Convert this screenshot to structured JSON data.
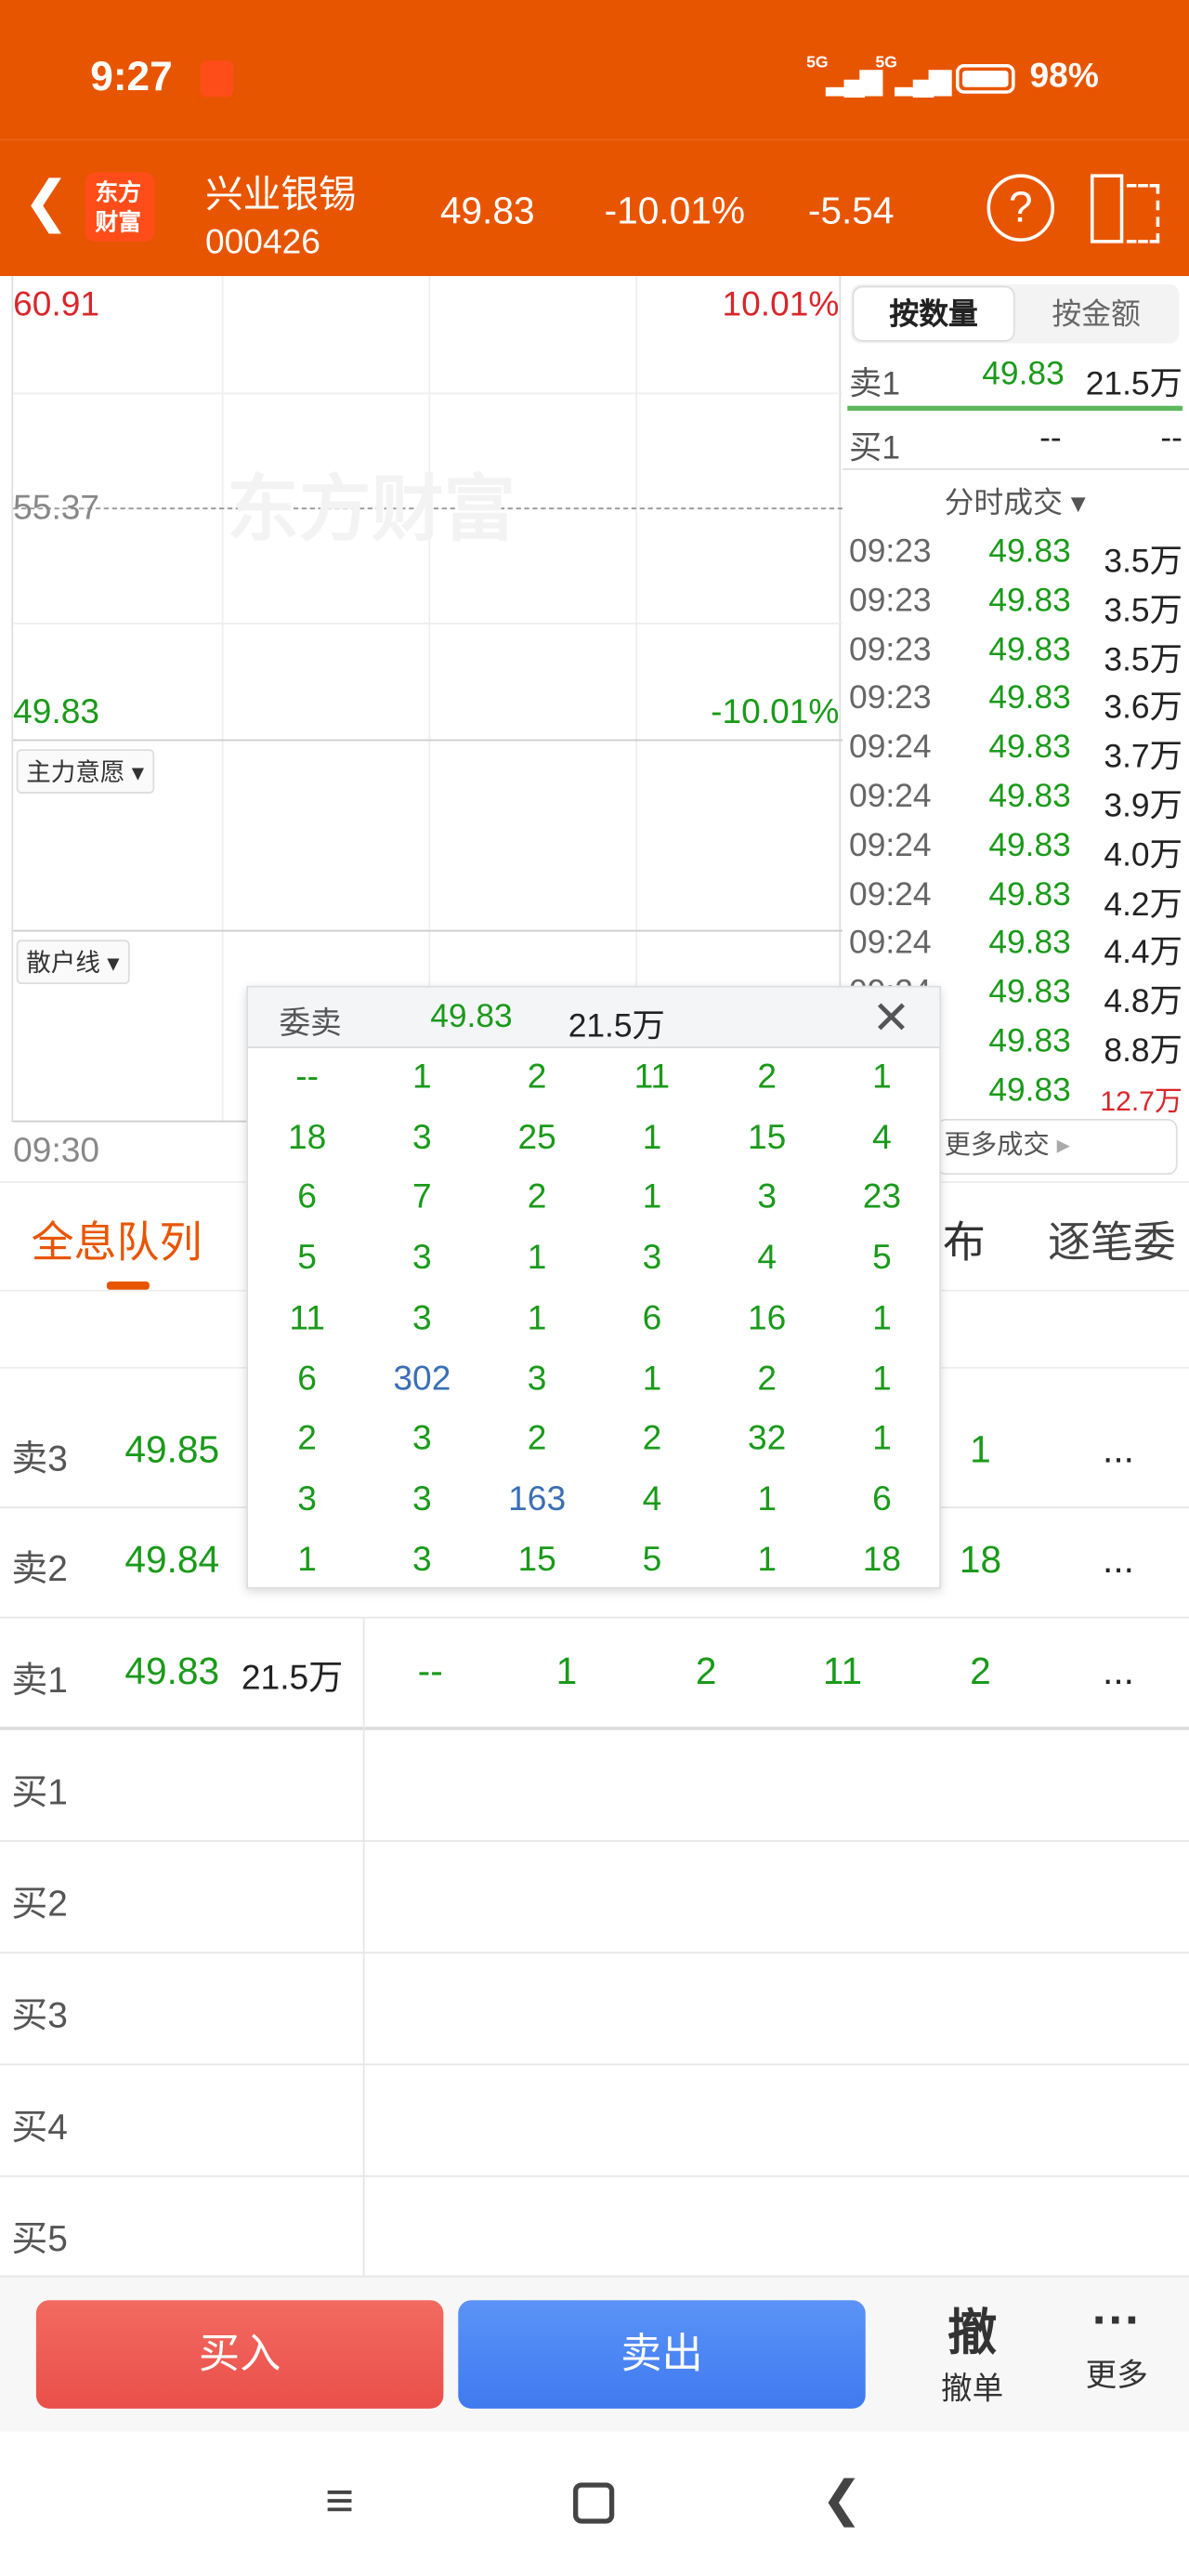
{
  "status": {
    "time": "9:27",
    "net1": "5G",
    "net2": "5G",
    "battery": "98%"
  },
  "header": {
    "logo_text": "东方财富",
    "name": "兴业银锡",
    "code": "000426",
    "price": "49.83",
    "change_pct": "-10.01%",
    "change": "-5.54"
  },
  "chart": {
    "high": "60.91",
    "high_pct": "10.01%",
    "mid": "55.37",
    "low": "49.83",
    "low_pct": "-10.01%",
    "watermark": "东方财富",
    "indicator1": "主力意愿",
    "indicator2": "散户线",
    "time_start": "09:30"
  },
  "side": {
    "tab_qty": "按数量",
    "tab_amt": "按金额",
    "sell1": {
      "label": "卖1",
      "price": "49.83",
      "vol": "21.5万"
    },
    "buy1": {
      "label": "买1",
      "price": "--",
      "vol": "--"
    },
    "trades_title": "分时成交",
    "more": "更多成交",
    "trades": [
      [
        "09:23",
        "49.83",
        "3.5万"
      ],
      [
        "09:23",
        "49.83",
        "3.5万"
      ],
      [
        "09:23",
        "49.83",
        "3.5万"
      ],
      [
        "09:23",
        "49.83",
        "3.6万"
      ],
      [
        "09:24",
        "49.83",
        "3.7万"
      ],
      [
        "09:24",
        "49.83",
        "3.9万"
      ],
      [
        "09:24",
        "49.83",
        "4.0万"
      ],
      [
        "09:24",
        "49.83",
        "4.2万"
      ],
      [
        "09:24",
        "49.83",
        "4.4万"
      ],
      [
        "09:24",
        "49.83",
        "4.8万"
      ],
      [
        "",
        "49.83",
        "8.8万"
      ],
      [
        "",
        "49.83",
        "12.7万"
      ]
    ]
  },
  "tabs": [
    "全息队列",
    "布",
    "逐笔委"
  ],
  "book": {
    "sell3": {
      "label": "卖3",
      "price": "49.85",
      "cells": [
        "",
        "",
        "",
        "",
        "1",
        "..."
      ]
    },
    "sell2": {
      "label": "卖2",
      "price": "49.84",
      "cells": [
        "",
        "",
        "",
        "",
        "18",
        "..."
      ]
    },
    "sell1": {
      "label": "卖1",
      "price": "49.83",
      "vol": "21.5万",
      "cells": [
        "--",
        "1",
        "2",
        "11",
        "2",
        "..."
      ]
    },
    "buys": [
      "买1",
      "买2",
      "买3",
      "买4",
      "买5"
    ]
  },
  "popup": {
    "title": "委卖",
    "price": "49.83",
    "vol": "21.5万",
    "rows": [
      [
        "--",
        "1",
        "2",
        "11",
        "2",
        "1"
      ],
      [
        "18",
        "3",
        "25",
        "1",
        "15",
        "4"
      ],
      [
        "6",
        "7",
        "2",
        "1",
        "3",
        "23"
      ],
      [
        "5",
        "3",
        "1",
        "3",
        "4",
        "5"
      ],
      [
        "11",
        "3",
        "1",
        "6",
        "16",
        "1"
      ],
      [
        "6",
        "302",
        "3",
        "1",
        "2",
        "1"
      ],
      [
        "2",
        "3",
        "2",
        "2",
        "32",
        "1"
      ],
      [
        "3",
        "3",
        "163",
        "4",
        "1",
        "6"
      ],
      [
        "1",
        "3",
        "15",
        "5",
        "1",
        "18"
      ]
    ],
    "highlight": [
      "302",
      "163"
    ]
  },
  "bottom": {
    "buy": "买入",
    "sell": "卖出",
    "cancel_icon": "撤",
    "cancel": "撤单",
    "more": "更多"
  },
  "colors": {
    "brand": "#E85500",
    "up": "#d9262b",
    "down": "#1a9a1a",
    "buy": "#ef5b55",
    "sell": "#4a86f5"
  }
}
